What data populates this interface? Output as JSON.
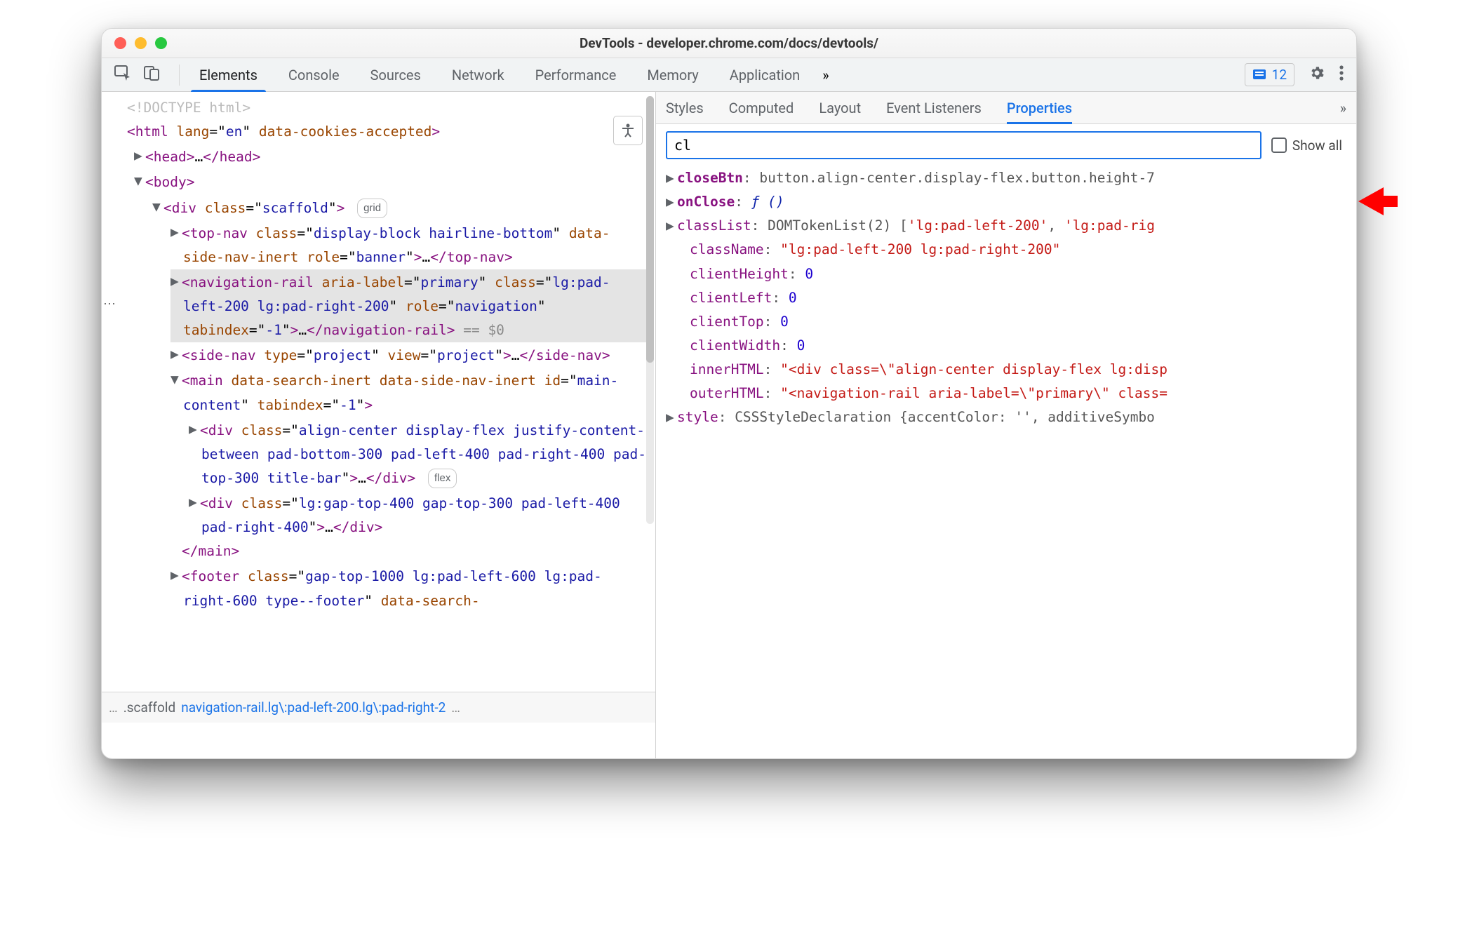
{
  "title": "DevTools - developer.chrome.com/docs/devtools/",
  "traffic_lights": {
    "close": "#ff5f57",
    "min": "#febc2e",
    "max": "#28c840"
  },
  "issues_count": "12",
  "main_tabs": [
    "Elements",
    "Console",
    "Sources",
    "Network",
    "Performance",
    "Memory",
    "Application"
  ],
  "main_tab_active": "Elements",
  "side_tabs": [
    "Styles",
    "Computed",
    "Layout",
    "Event Listeners",
    "Properties"
  ],
  "side_tab_active": "Properties",
  "filter_value": "cl",
  "show_all_label": "Show all",
  "show_all_checked": false,
  "dom_lines": [
    {
      "indent": 0,
      "arrow": "none",
      "html": "<span class='doctype'>&lt;!DOCTYPE html&gt;</span>"
    },
    {
      "indent": 0,
      "arrow": "none",
      "html": "<span class='tag'>&lt;html</span> <span class='attrn'>lang</span>=\"<span class='attrv'>en</span>\" <span class='attrn'>data-cookies-accepted</span><span class='tag'>&gt;</span>"
    },
    {
      "indent": 1,
      "arrow": "right",
      "html": "<span class='tag'>&lt;head&gt;</span>…<span class='tag'>&lt;/head&gt;</span>"
    },
    {
      "indent": 1,
      "arrow": "down",
      "html": "<span class='tag'>&lt;body&gt;</span>"
    },
    {
      "indent": 2,
      "arrow": "down",
      "html": "<span class='tag'>&lt;div</span> <span class='attrn'>class</span>=\"<span class='attrv'>scaffold</span>\"<span class='tag'>&gt;</span> <span class='badge'>grid</span>"
    },
    {
      "indent": 3,
      "arrow": "right",
      "html": "<span class='tag'>&lt;top-nav</span> <span class='attrn'>class</span>=\"<span class='attrv'>display-block hairline-bottom</span>\" <span class='attrn'>data-side-nav-inert</span> <span class='attrn'>role</span>=\"<span class='attrv'>banner</span>\"<span class='tag'>&gt;</span>…<span class='tag'>&lt;/top-nav&gt;</span>"
    },
    {
      "indent": 3,
      "arrow": "right",
      "selected": true,
      "html": "<span class='tag'>&lt;navigation-rail</span> <span class='attrn'>aria-label</span>=\"<span class='attrv'>primary</span>\" <span class='attrn'>class</span>=\"<span class='attrv'>lg:pad-left-200 lg:pad-right-200</span>\" <span class='attrn'>role</span>=\"<span class='attrv'>navigation</span>\" <span class='attrn'>tabindex</span>=\"<span class='attrv'>-1</span>\"<span class='tag'>&gt;</span>…<span class='tag'>&lt;/navigation-rail&gt;</span> <span class='eq-dollar'>== $0</span>"
    },
    {
      "indent": 3,
      "arrow": "right",
      "html": "<span class='tag'>&lt;side-nav</span> <span class='attrn'>type</span>=\"<span class='attrv'>project</span>\" <span class='attrn'>view</span>=\"<span class='attrv'>project</span>\"<span class='tag'>&gt;</span>…<span class='tag'>&lt;/side-nav&gt;</span>"
    },
    {
      "indent": 3,
      "arrow": "down",
      "html": "<span class='tag'>&lt;main</span> <span class='attrn'>data-search-inert</span> <span class='attrn'>data-side-nav-inert</span> <span class='attrn'>id</span>=\"<span class='attrv'>main-content</span>\" <span class='attrn'>tabindex</span>=\"<span class='attrv'>-1</span>\"<span class='tag'>&gt;</span>"
    },
    {
      "indent": 4,
      "arrow": "right",
      "html": "<span class='tag'>&lt;div</span> <span class='attrn'>class</span>=\"<span class='attrv'>align-center display-flex justify-content-between pad-bottom-300 pad-left-400 pad-right-400 pad-top-300 title-bar</span>\"<span class='tag'>&gt;</span>…<span class='tag'>&lt;/div&gt;</span> <span class='badge'>flex</span>"
    },
    {
      "indent": 4,
      "arrow": "right",
      "html": "<span class='tag'>&lt;div</span> <span class='attrn'>class</span>=\"<span class='attrv'>lg:gap-top-400 gap-top-300 pad-left-400 pad-right-400</span>\"<span class='tag'>&gt;</span>…<span class='tag'>&lt;/div&gt;</span>"
    },
    {
      "indent": 3,
      "arrow": "none",
      "html": "<span class='tag'>&lt;/main&gt;</span>"
    },
    {
      "indent": 3,
      "arrow": "right",
      "html": "<span class='tag'>&lt;footer</span> <span class='attrn'>class</span>=\"<span class='attrv'>gap-top-1000 lg:pad-left-600 lg:pad-right-600 type--footer</span>\" <span class='attrn'>data-search-</span>"
    }
  ],
  "breadcrumbs": {
    "left_ellipsis": "…",
    "scaffold": ".scaffold",
    "active": "navigation-rail.lg\\:pad-left-200.lg\\:pad-right-2",
    "right_ellipsis": "…"
  },
  "properties": [
    {
      "arrow": true,
      "key": "closeBtn",
      "ksty": "pn-bold",
      "val": "button.align-center.display-flex.button.height-7",
      "vsty": "ps-navy"
    },
    {
      "arrow": true,
      "key": "onClose",
      "ksty": "pn-bold",
      "val": "ƒ ()",
      "vsty": "pv-fn"
    },
    {
      "arrow": true,
      "key": "classList",
      "ksty": "pn",
      "val": "DOMTokenList(2) ['lg:pad-left-200', 'lg:pad-rig",
      "vsty": "ps-navy",
      "vtail": "string-list"
    },
    {
      "arrow": false,
      "key": "className",
      "ksty": "pn",
      "val": "\"lg:pad-left-200 lg:pad-right-200\"",
      "vsty": "pv-string"
    },
    {
      "arrow": false,
      "key": "clientHeight",
      "ksty": "pn",
      "val": "0",
      "vsty": "pv-num"
    },
    {
      "arrow": false,
      "key": "clientLeft",
      "ksty": "pn",
      "val": "0",
      "vsty": "pv-num"
    },
    {
      "arrow": false,
      "key": "clientTop",
      "ksty": "pn",
      "val": "0",
      "vsty": "pv-num"
    },
    {
      "arrow": false,
      "key": "clientWidth",
      "ksty": "pn",
      "val": "0",
      "vsty": "pv-num"
    },
    {
      "arrow": false,
      "key": "innerHTML",
      "ksty": "pn",
      "val": "\"<div class=\\\"align-center display-flex lg:disp",
      "vsty": "pv-string"
    },
    {
      "arrow": false,
      "key": "outerHTML",
      "ksty": "pn",
      "val": "\"<navigation-rail aria-label=\\\"primary\\\" class=",
      "vsty": "pv-string"
    },
    {
      "arrow": true,
      "key": "style",
      "ksty": "pn",
      "val": "CSSStyleDeclaration {accentColor: '', additiveSymbo",
      "vsty": "ps-navy"
    }
  ]
}
